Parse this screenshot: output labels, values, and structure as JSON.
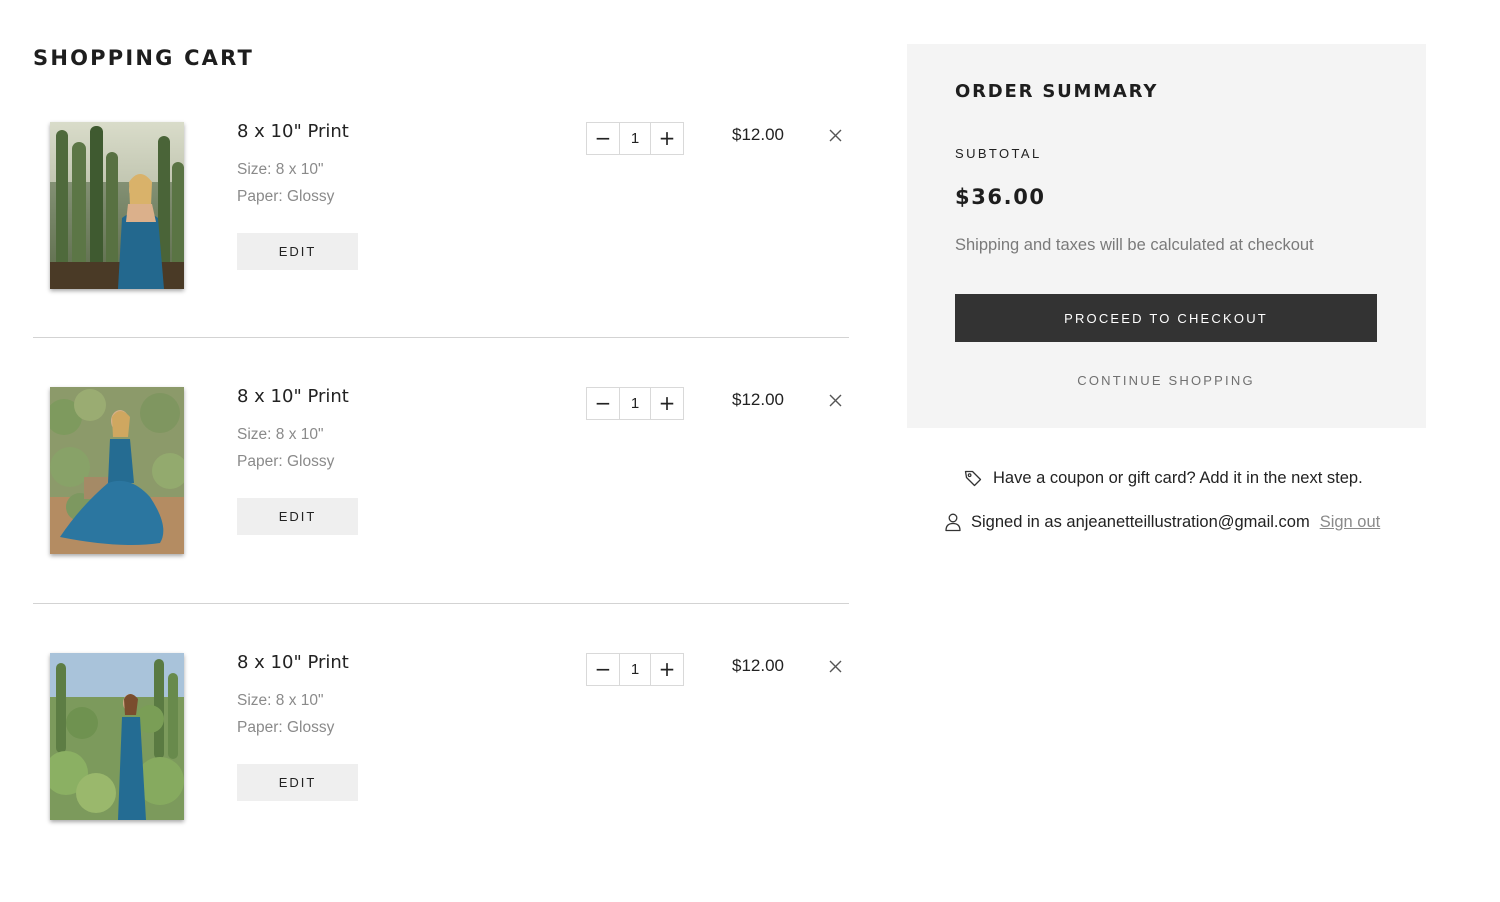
{
  "page": {
    "title": "SHOPPING CART"
  },
  "cart": {
    "items": [
      {
        "name": "8 x 10\" Print",
        "size": "Size: 8 x 10\"",
        "paper": "Paper: Glossy",
        "edit_label": "EDIT",
        "quantity": "1",
        "price": "$12.00",
        "decrement_symbol": "−",
        "increment_symbol": "+",
        "thumbnail_icon": "photo-cactus-portrait"
      },
      {
        "name": "8 x 10\" Print",
        "size": "Size: 8 x 10\"",
        "paper": "Paper: Glossy",
        "edit_label": "EDIT",
        "quantity": "1",
        "price": "$12.00",
        "decrement_symbol": "−",
        "increment_symbol": "+",
        "thumbnail_icon": "photo-seated-garden"
      },
      {
        "name": "8 x 10\" Print",
        "size": "Size: 8 x 10\"",
        "paper": "Paper: Glossy",
        "edit_label": "EDIT",
        "quantity": "1",
        "price": "$12.00",
        "decrement_symbol": "−",
        "increment_symbol": "+",
        "thumbnail_icon": "photo-standing-garden"
      }
    ]
  },
  "summary": {
    "title": "ORDER SUMMARY",
    "subtotal_label": "SUBTOTAL",
    "subtotal_amount": "$36.00",
    "shipping_note": "Shipping and taxes will be calculated at checkout",
    "checkout_label": "PROCEED TO CHECKOUT",
    "continue_label": "CONTINUE SHOPPING"
  },
  "coupon": {
    "text": "Have a coupon or gift card? Add it in the next step.",
    "icon": "tag-icon"
  },
  "account": {
    "signed_in_text": "Signed in as anjeanetteillustration@gmail.com",
    "sign_out_label": "Sign out",
    "icon": "user-icon"
  },
  "colors": {
    "checkout_button": "#333333",
    "summary_background": "#f4f4f4",
    "edit_button": "#efefef",
    "muted_text": "#8a8a8a"
  }
}
